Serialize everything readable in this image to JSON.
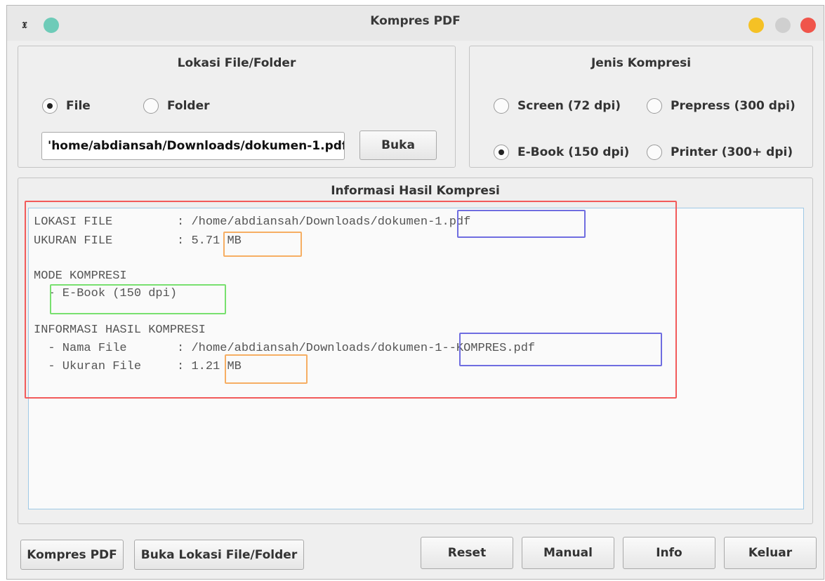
{
  "window": {
    "title": "Kompres PDF",
    "app_icon": "x-icon"
  },
  "colors": {
    "dot_teal": "#6ecbb8",
    "dot_yellow": "#f5c125",
    "dot_grey": "#cfcfcf",
    "dot_red": "#f0554b",
    "highlight_red": "#f25a5a",
    "highlight_blue": "#6f6de0",
    "highlight_orange": "#f6ae63",
    "highlight_green": "#78e06f"
  },
  "location_group": {
    "title": "Lokasi File/Folder",
    "radio_file": "File",
    "radio_folder": "Folder",
    "selected": "File",
    "path_value": "'home/abdiansah/Downloads/dokumen-1.pdf",
    "open_button": "Buka"
  },
  "compression_group": {
    "title": "Jenis Kompresi",
    "options": [
      "Screen (72 dpi)",
      "Prepress (300 dpi)",
      "E-Book (150 dpi)",
      "Printer (300+ dpi)"
    ],
    "selected": "E-Book (150 dpi)"
  },
  "result_group": {
    "title": "Informasi Hasil Kompresi",
    "lines": {
      "l1_label": "LOKASI FILE         : ",
      "l1_path": "/home/abdiansah/Downloads/",
      "l1_file": "dokumen-1.pdf",
      "l2_label": "UKURAN FILE         : ",
      "l2_value": "5.71 MB",
      "l4": "MODE KOMPRESI",
      "l5": "  - E-Book (150 dpi)",
      "l7": "INFORMASI HASIL KOMPRESI",
      "l8_label": "  - Nama File       : ",
      "l8_path": "/home/abdiansah/Downloads/",
      "l8_file": "dokumen-1--KOMPRES.pdf",
      "l9_label": "  - Ukuran File     : ",
      "l9_value": "1.21 MB"
    }
  },
  "bottom_buttons": {
    "compress": "Kompres PDF",
    "open_location": "Buka Lokasi File/Folder",
    "reset": "Reset",
    "manual": "Manual",
    "info": "Info",
    "exit": "Keluar"
  }
}
